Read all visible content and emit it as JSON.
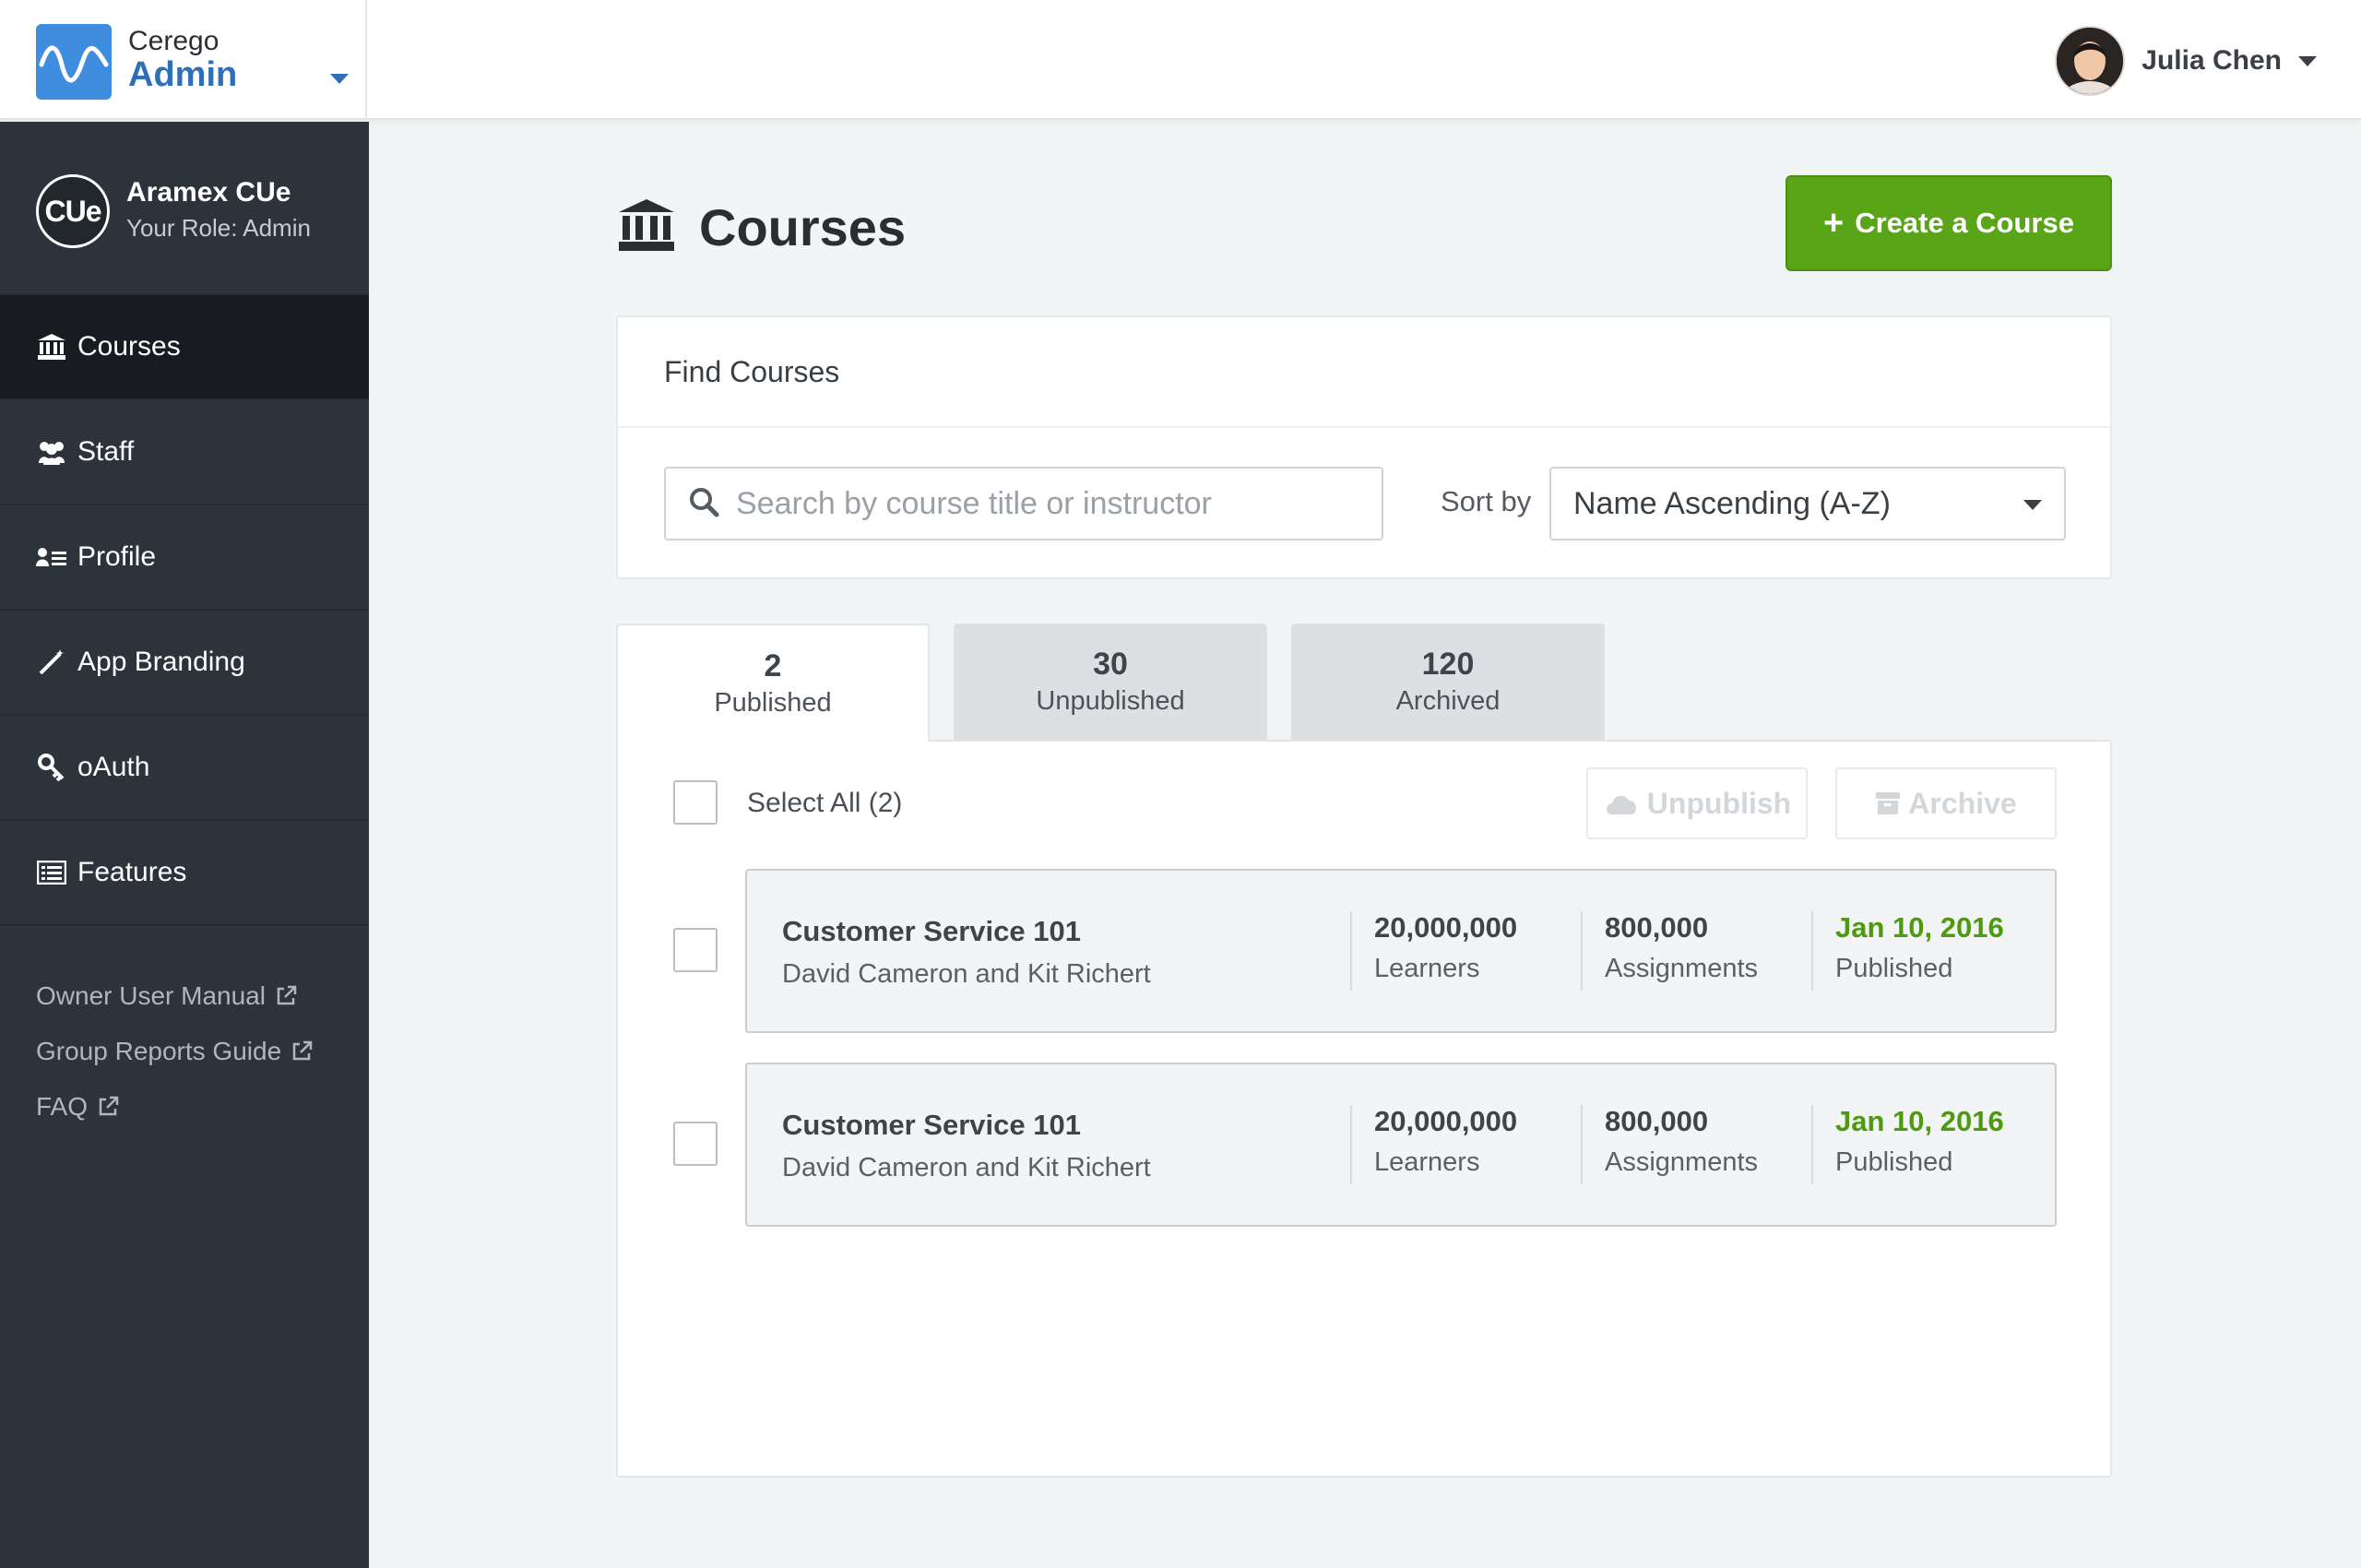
{
  "header": {
    "brand_small": "Cerego",
    "brand_big": "Admin",
    "user_name": "Julia Chen"
  },
  "sidebar": {
    "org_logo_text": "CUe",
    "org_name": "Aramex CUe",
    "org_role": "Your Role: Admin",
    "items": [
      {
        "label": "Courses",
        "icon": "bank-icon",
        "active": true
      },
      {
        "label": "Staff",
        "icon": "users-icon"
      },
      {
        "label": "Profile",
        "icon": "profile-list-icon"
      },
      {
        "label": "App Branding",
        "icon": "magic-wand-icon"
      },
      {
        "label": "oAuth",
        "icon": "key-icon"
      },
      {
        "label": "Features",
        "icon": "list-alt-icon"
      }
    ],
    "links": [
      {
        "label": "Owner User Manual",
        "icon": "external-link-icon"
      },
      {
        "label": "Group Reports Guide",
        "icon": "external-link-icon"
      },
      {
        "label": "FAQ",
        "icon": "external-link-icon"
      }
    ]
  },
  "main": {
    "title": "Courses",
    "create_label": "Create a Course",
    "create_color": "#5aa517",
    "find": {
      "title": "Find Courses",
      "search_placeholder": "Search by course title or instructor",
      "sort_label": "Sort by",
      "sort_value": "Name Ascending (A-Z)"
    },
    "tabs": [
      {
        "count": "2",
        "label": "Published",
        "active": true
      },
      {
        "count": "30",
        "label": "Unpublished"
      },
      {
        "count": "120",
        "label": "Archived"
      }
    ],
    "select_all_label": "Select All (2)",
    "bulk_actions": {
      "unpublish": "Unpublish",
      "archive": "Archive"
    },
    "courses": [
      {
        "title": "Customer Service 101",
        "instructors": "David Cameron and Kit Richert",
        "learners_value": "20,000,000",
        "learners_label": "Learners",
        "assignments_value": "800,000",
        "assignments_label": "Assignments",
        "date": "Jan 10, 2016",
        "status": "Published"
      },
      {
        "title": "Customer Service 101",
        "instructors": "David Cameron and Kit Richert",
        "learners_value": "20,000,000",
        "learners_label": "Learners",
        "assignments_value": "800,000",
        "assignments_label": "Assignments",
        "date": "Jan 10, 2016",
        "status": "Published"
      }
    ],
    "status_color": "#4e9a0f"
  }
}
